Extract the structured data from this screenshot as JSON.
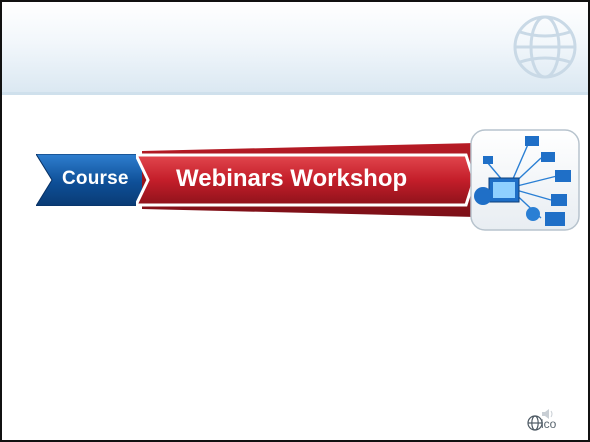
{
  "slide": {
    "course_label": "Course",
    "title": "Webinars Workshop",
    "footer_logo_text": "ico"
  },
  "colors": {
    "course_blue": "#0e4f97",
    "title_red": "#c41e2a",
    "header_band": "#dbe8f2",
    "globe_watermark": "#c9d9e6"
  },
  "icons": [
    "globe-watermark-icon",
    "network-computers-icon",
    "globe-logo-icon",
    "speaker-icon"
  ]
}
